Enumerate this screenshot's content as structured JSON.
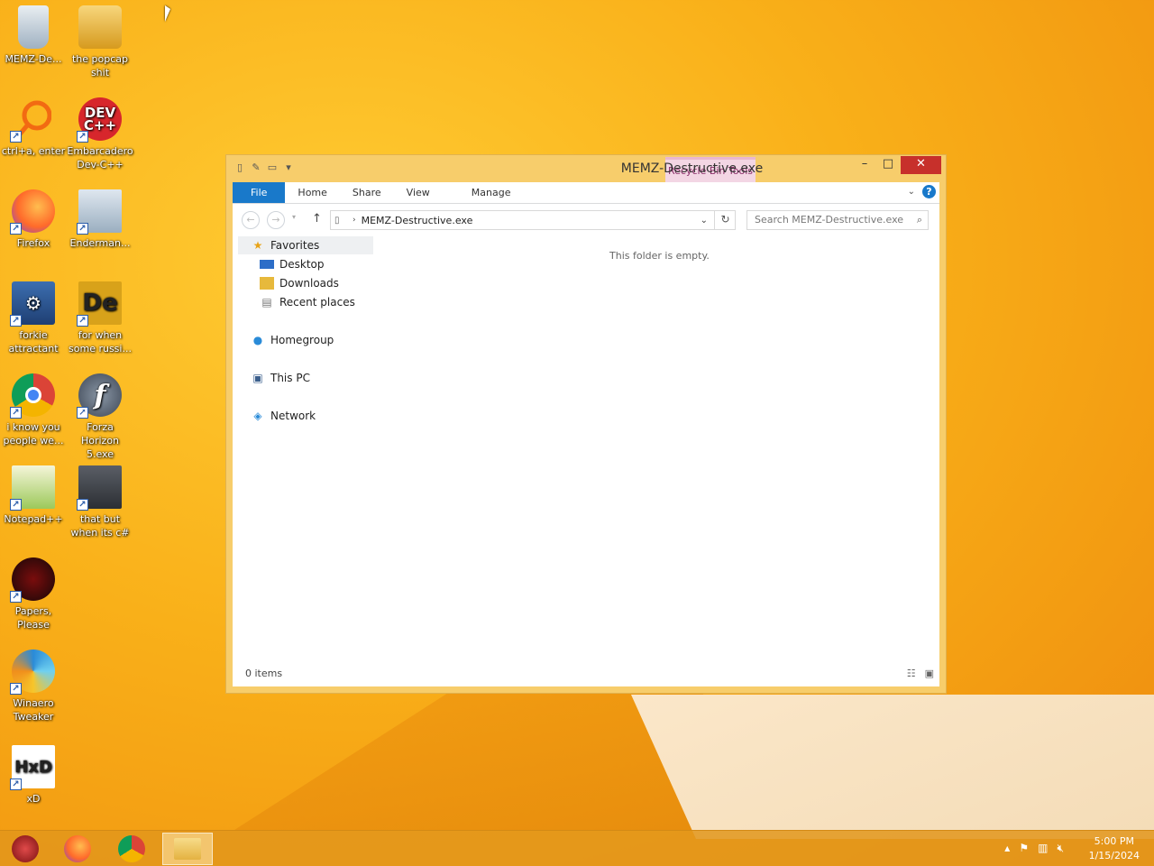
{
  "desktop": {
    "icons": [
      {
        "label": "MEMZ-De...",
        "icon": "recycle-bin-icon"
      },
      {
        "label": "the popcap shit",
        "icon": "folder-icon"
      },
      {
        "label": "ctrl+a, enter",
        "icon": "search-app-icon"
      },
      {
        "label": "Embarcadero Dev-C++",
        "icon": "dev-cpp-icon",
        "badge": "DEV C++"
      },
      {
        "label": "Firefox",
        "icon": "firefox-icon"
      },
      {
        "label": "Enderman...",
        "icon": "window-app-icon"
      },
      {
        "label": "forkie attractant",
        "icon": "control-panel-icon"
      },
      {
        "label": "for when some russi...",
        "icon": "de-app-icon",
        "badge": "De"
      },
      {
        "label": "i know you people we...",
        "icon": "chrome-icon"
      },
      {
        "label": "Forza Horizon 5.exe",
        "icon": "flash-icon",
        "badge": "f"
      },
      {
        "label": "Notepad++",
        "icon": "notepadpp-icon"
      },
      {
        "label": "that but when its c#",
        "icon": "stacked-windows-icon"
      },
      {
        "label": "Papers, Please",
        "icon": "papers-please-icon"
      },
      {
        "label": "Winaero Tweaker",
        "icon": "winaero-icon"
      },
      {
        "label": "xD",
        "icon": "hxd-icon",
        "badge": "HxD"
      }
    ]
  },
  "window": {
    "title": "MEMZ-Destructive.exe",
    "context_tab": "Recycle Bin Tools",
    "ribbon_tabs": [
      "File",
      "Home",
      "Share",
      "View",
      "Manage"
    ],
    "address": "MEMZ-Destructive.exe",
    "search_placeholder": "Search MEMZ-Destructive.exe",
    "nav": {
      "favorites": "Favorites",
      "desktop": "Desktop",
      "downloads": "Downloads",
      "recent": "Recent places",
      "homegroup": "Homegroup",
      "this_pc": "This PC",
      "network": "Network"
    },
    "empty_message": "This folder is empty.",
    "status": "0 items"
  },
  "taskbar": {
    "apps": [
      "memz-app-icon",
      "firefox-icon",
      "chrome-icon",
      "file-explorer-icon"
    ],
    "time": "5:00 PM",
    "date": "1/15/2024"
  },
  "colors": {
    "accent": "#1979ca",
    "close": "#c7302b",
    "frame": "#f7cd6b"
  }
}
